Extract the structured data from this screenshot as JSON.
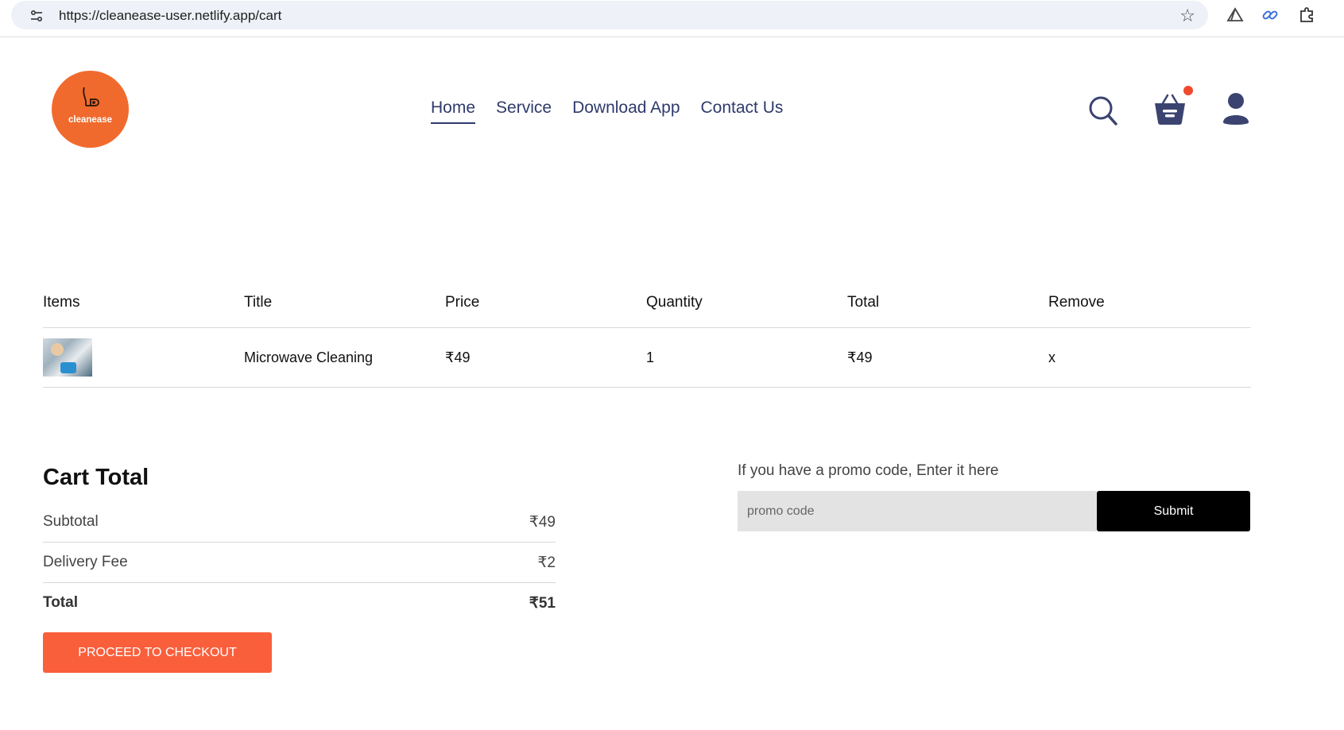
{
  "browser": {
    "url": "https://cleanease-user.netlify.app/cart"
  },
  "header": {
    "logo_text": "cleanease",
    "nav": [
      {
        "label": "Home",
        "active": true
      },
      {
        "label": "Service"
      },
      {
        "label": "Download App"
      },
      {
        "label": "Contact Us"
      }
    ],
    "icons": [
      "search-icon",
      "basket-icon",
      "profile-icon"
    ]
  },
  "cart": {
    "columns": [
      "Items",
      "Title",
      "Price",
      "Quantity",
      "Total",
      "Remove"
    ],
    "rows": [
      {
        "title": "Microwave Cleaning",
        "price": "₹49",
        "quantity": "1",
        "total": "₹49",
        "remove": "x"
      }
    ]
  },
  "cart_total": {
    "heading": "Cart Total",
    "subtotal_label": "Subtotal",
    "subtotal_value": "₹49",
    "delivery_label": "Delivery Fee",
    "delivery_value": "₹2",
    "total_label": "Total",
    "total_value": "₹51",
    "checkout_label": "PROCEED TO CHECKOUT"
  },
  "promo": {
    "label": "If you have a promo code, Enter it here",
    "placeholder": "promo code",
    "submit_label": "Submit"
  },
  "colors": {
    "accent": "#fa5f3c",
    "brand": "#f16a2d",
    "nav_text": "#2f3a6b"
  }
}
